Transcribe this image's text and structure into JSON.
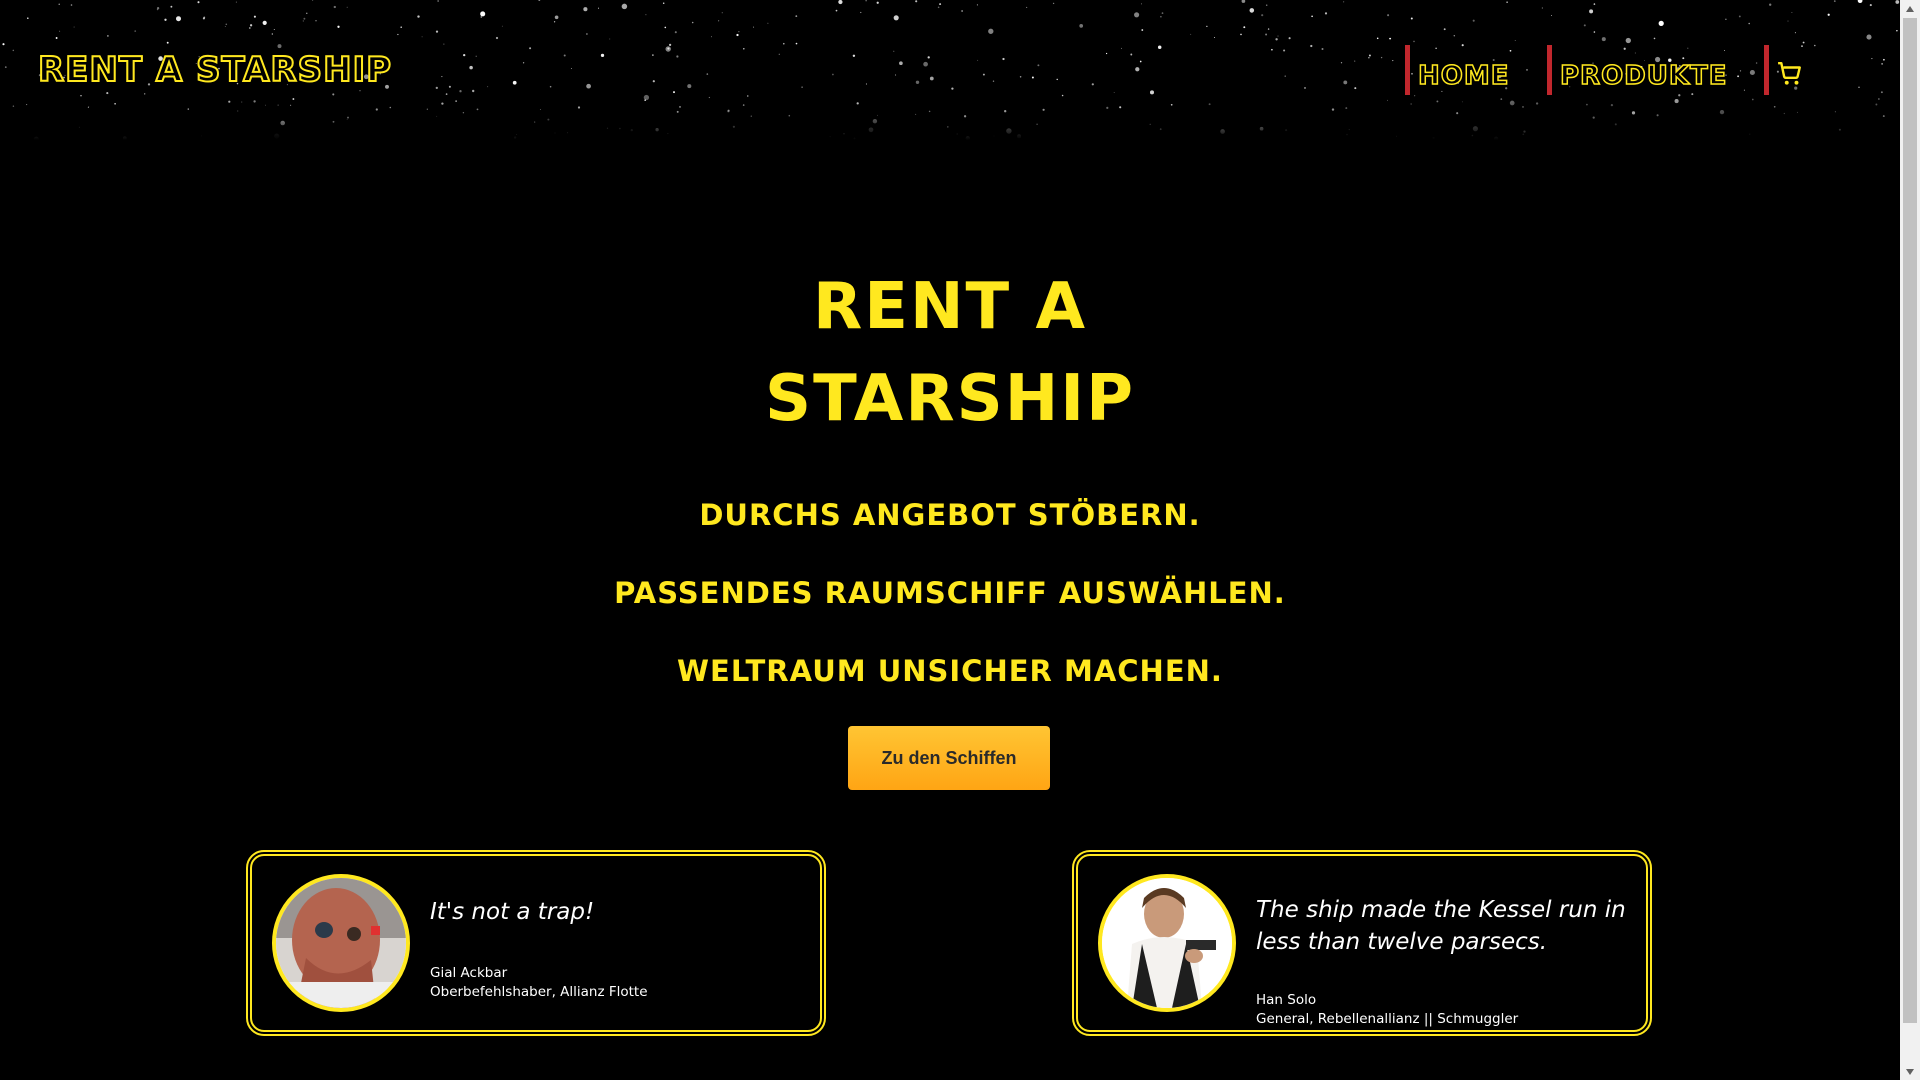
{
  "header": {
    "logo": "Rent a Starship",
    "nav": {
      "home": "Home",
      "produkte": "Produkte",
      "cart_icon": "cart-icon"
    }
  },
  "hero": {
    "title_line1": "Rent a",
    "title_line2": "Starship",
    "taglines": [
      "Durchs Angebot stöbern.",
      "Passendes Raumschiff auswählen.",
      "Weltraum unsicher machen."
    ],
    "cta_label": "Zu den Schiffen"
  },
  "testimonials": [
    {
      "quote": "It's not a trap!",
      "name": "Gial Ackbar",
      "role": "Oberbefehlshaber, Allianz Flotte"
    },
    {
      "quote": "The ship made the Kessel run in less than twelve parsecs.",
      "name": "Han Solo",
      "role": "General, Rebellenallianz || Schmuggler"
    }
  ],
  "colors": {
    "accent": "#ffe81f",
    "nav_border": "#c1272d",
    "button": "#ffb623",
    "background": "#000000"
  }
}
